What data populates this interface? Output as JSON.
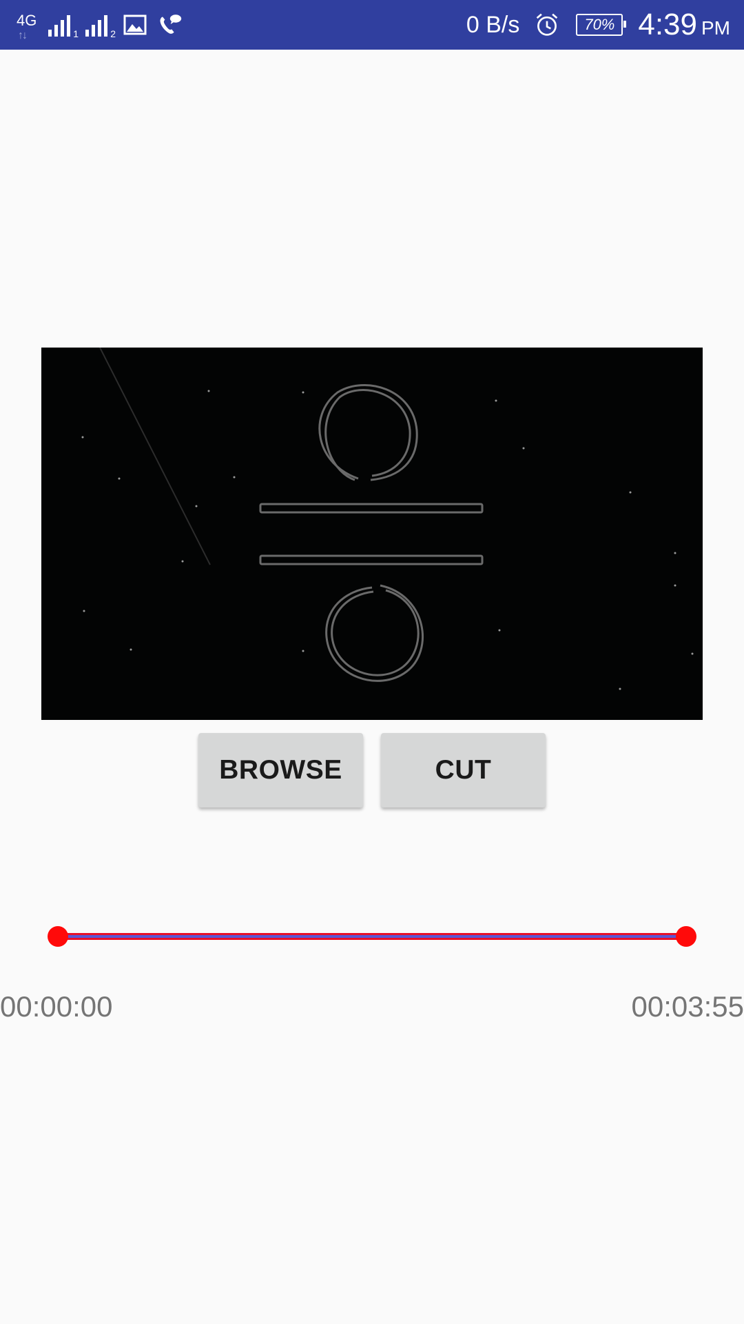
{
  "status_bar": {
    "network_type": "4G",
    "sim1_sub": "1",
    "sim2_sub": "2",
    "speed": "0 B/s",
    "battery": "70%",
    "time": "4:39",
    "ampm": "PM",
    "icons": [
      "signal-sim1-icon",
      "signal-sim2-icon",
      "image-notification-icon",
      "wifi-calling-icon",
      "alarm-icon",
      "battery-icon"
    ]
  },
  "actions": {
    "browse_label": "BROWSE",
    "cut_label": "CUT"
  },
  "trim_range": {
    "start_time": "00:00:00",
    "end_time": "00:03:55",
    "start_fraction": 0.0,
    "end_fraction": 1.0
  },
  "colors": {
    "status_bar": "#303f9f",
    "background": "#fafafa",
    "button": "#d6d7d7",
    "slider_thumb": "#ff0a0a",
    "slider_track": "#e8102a",
    "slider_selected": "#5a56d4",
    "time_text": "#757575"
  }
}
